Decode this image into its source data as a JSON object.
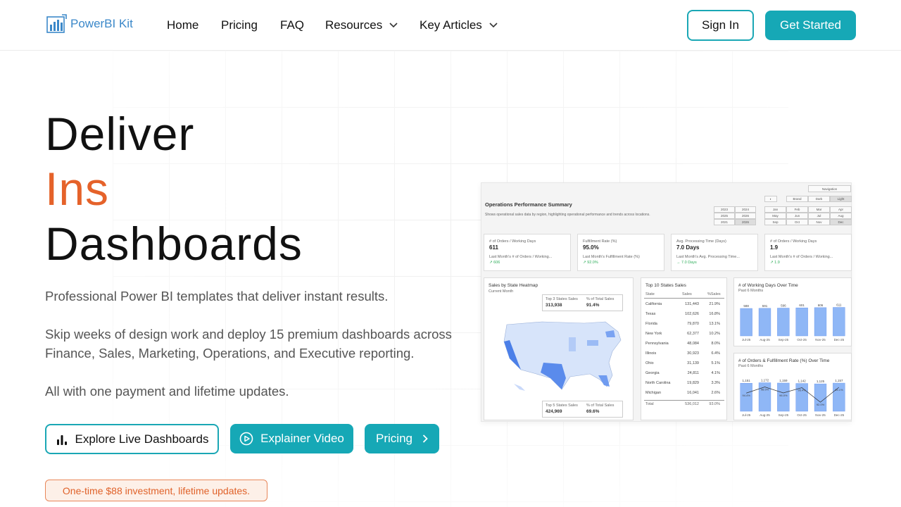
{
  "brand": {
    "name": "PowerBI Kit"
  },
  "nav": {
    "home": "Home",
    "pricing": "Pricing",
    "faq": "FAQ",
    "resources": "Resources",
    "key_articles": "Key Articles",
    "sign_in": "Sign In",
    "get_started": "Get Started"
  },
  "hero": {
    "line1": "Deliver",
    "line2": "Ins",
    "line3": "Dashboards",
    "p1": "Professional Power BI templates that deliver instant results.",
    "p2": "Skip weeks of design work and deploy 15 premium dashboards across Finance, Sales, Marketing, Operations, and Executive reporting.",
    "p3": "All with one payment and lifetime updates.",
    "btn_explore": "Explore Live Dashboards",
    "btn_video": "Explainer Video",
    "btn_pricing": "Pricing",
    "badge": "One-time $88 investment, lifetime updates."
  },
  "colors": {
    "accent": "#16a8b6",
    "orange": "#e5622a"
  },
  "dashboard": {
    "title": "Operations Performance Summary",
    "subtitle": "Shows operational sales data by region, highlighting operational performance and trends across locations.",
    "nav_button": "Navigation",
    "themes": [
      "Brand",
      "Dark",
      "Light"
    ],
    "years": [
      "2023",
      "2024",
      "2025",
      "2026",
      "2021",
      "2026"
    ],
    "months": [
      "Jan",
      "Feb",
      "Mar",
      "Apr",
      "May",
      "Jun",
      "Jul",
      "Aug",
      "Sep",
      "Oct",
      "Nov",
      "Dec"
    ],
    "kpis": [
      {
        "label": "# of Orders / Working Days",
        "value": "611",
        "sub": "Last Month's # of Orders / Working...",
        "delta": "↗ 606"
      },
      {
        "label": "Fulfillment Rate (%)",
        "value": "95.0%",
        "sub": "Last Month's Fulfillment Rate (%)",
        "delta": "↗ 92.0%"
      },
      {
        "label": "Avg. Processing Time (Days)",
        "value": "7.0 Days",
        "sub": "Last Month's Avg. Processing Time...",
        "delta": "→ 7.0 Days"
      },
      {
        "label": "# of Orders / Working Days",
        "value": "1.9",
        "sub": "Last Month's # of Orders / Working...",
        "delta": "↗ 1.9"
      }
    ],
    "map": {
      "title": "Sales by State Heatmap",
      "sub": "Current Month",
      "top3_label": "Top 3 States Sales",
      "top3_value": "313,938",
      "top3_pct_label": "% of Total Sales",
      "top3_pct": "91.4%",
      "top5_label": "Top 5 States Sales",
      "top5_value": "424,969",
      "top5_pct_label": "% of Total Sales",
      "top5_pct": "69.6%"
    },
    "table": {
      "title": "Top 10 States Sales",
      "headers": [
        "State",
        "Sales",
        "%Sales"
      ],
      "rows": [
        [
          "California",
          "131,443",
          "21.9%"
        ],
        [
          "Texas",
          "102,626",
          "16.8%"
        ],
        [
          "Florida",
          "79,870",
          "13.1%"
        ],
        [
          "New York",
          "62,377",
          "10.2%"
        ],
        [
          "Pennsylvania",
          "48,084",
          "8.0%"
        ],
        [
          "Illinois",
          "30,923",
          "6.4%"
        ],
        [
          "Ohio",
          "31,139",
          "5.1%"
        ],
        [
          "Georgia",
          "24,811",
          "4.1%"
        ],
        [
          "North Carolina",
          "19,829",
          "3.3%"
        ],
        [
          "Michigan",
          "16,041",
          "2.6%"
        ]
      ],
      "total": [
        "Total",
        "536,012",
        "93.0%"
      ]
    },
    "bar1": {
      "title": "# of Working Days Over Time",
      "sub": "Past 6 Months",
      "categories": [
        "Jul-25",
        "Aug-25",
        "Sep-25",
        "Oct-25",
        "Nov-25",
        "Dec-25"
      ],
      "values": [
        588,
        591,
        596,
        601,
        606,
        611
      ]
    },
    "bar2": {
      "title": "# of Orders & Fulfillment Rate (%) Over Time",
      "sub": "Past 6 Months",
      "categories": [
        "Jul-25",
        "Aug-25",
        "Sep-25",
        "Oct-25",
        "Nov-25",
        "Dec-25"
      ],
      "values": [
        1151,
        1172,
        1159,
        1142,
        1125,
        1157
      ],
      "labels": [
        "1,151",
        "1,172",
        "1,159",
        "1,142",
        "1,125",
        "1,157"
      ],
      "rates": [
        "94.4%",
        "98.5%",
        "96.0%",
        "95.4%",
        "92.0%",
        "95.1%"
      ]
    }
  }
}
